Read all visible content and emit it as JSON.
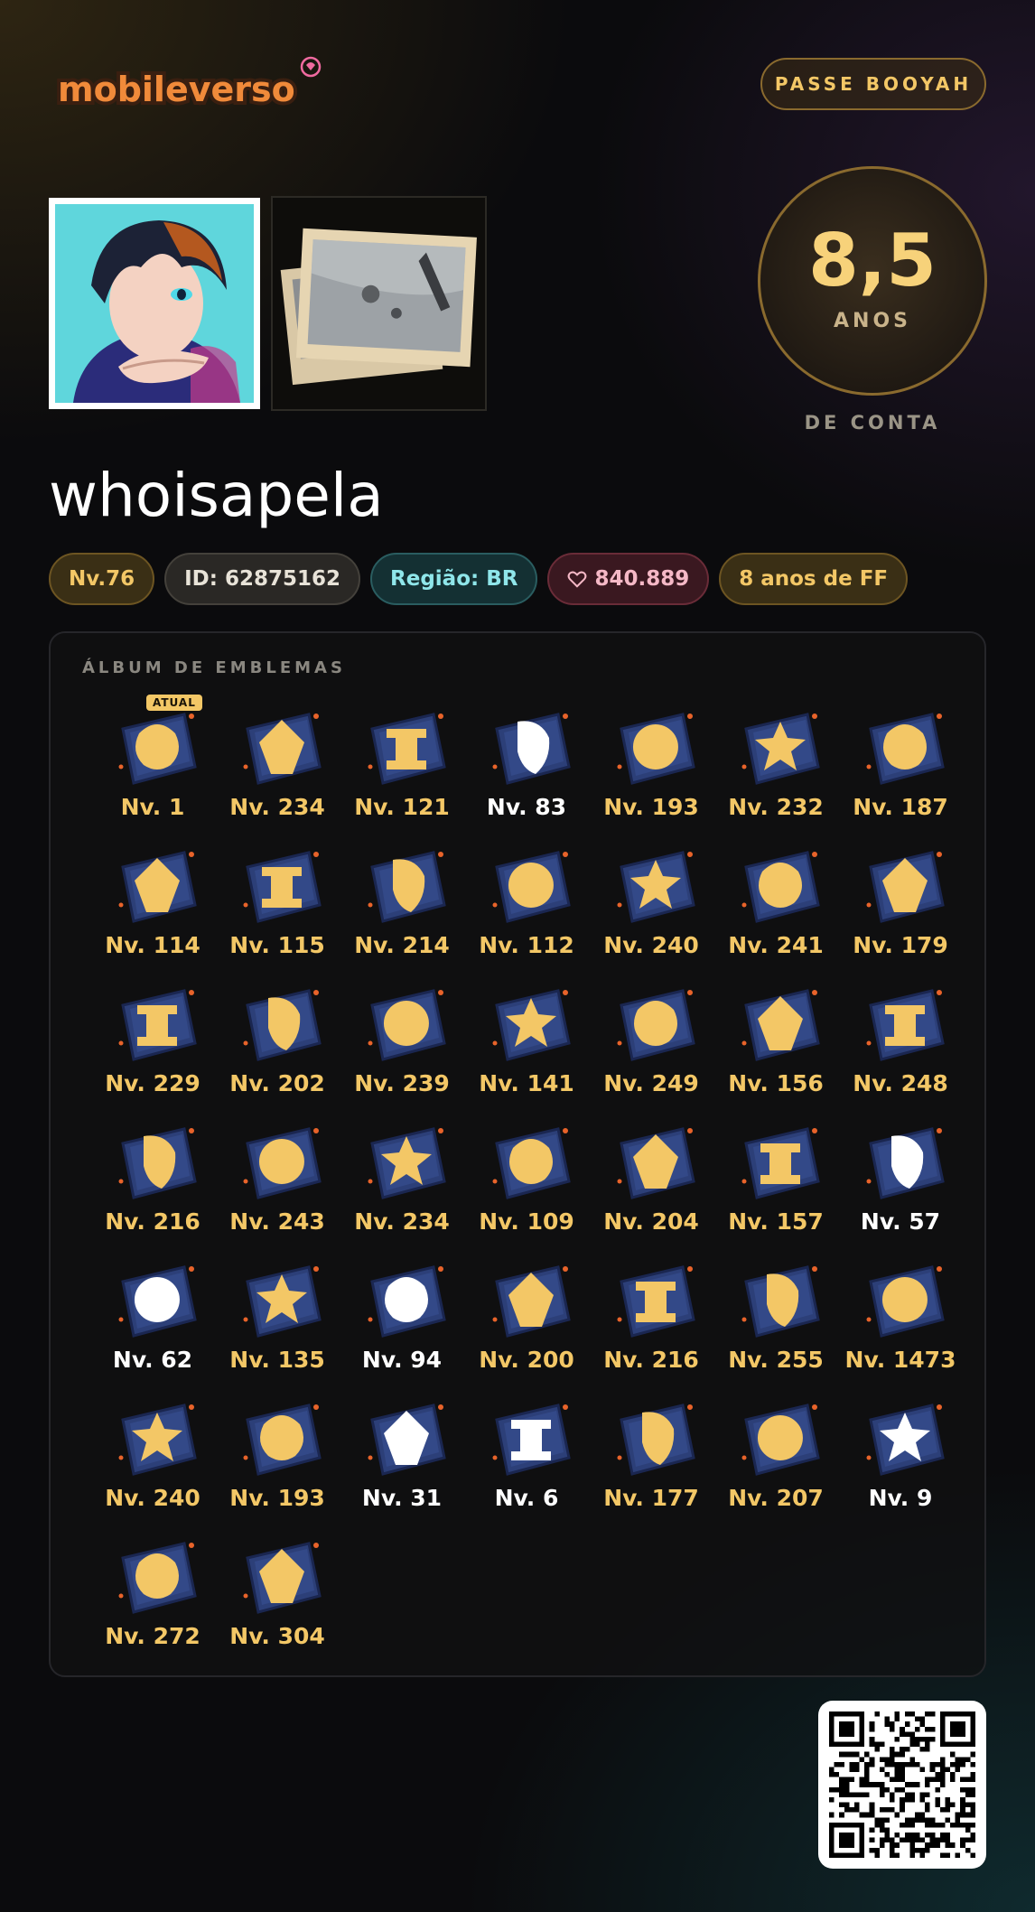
{
  "brand": {
    "logo_text": "mobileverso"
  },
  "header": {
    "pass_button": "PASSE BOOYAH"
  },
  "profile": {
    "years_value": "8,5",
    "years_unit": "ANOS",
    "years_caption": "DE CONTA",
    "username": "whoisapela",
    "pills": {
      "level": "Nv.76",
      "id": "ID: 62875162",
      "region": "Região: BR",
      "likes": "840.889",
      "years": "8 anos de FF"
    }
  },
  "album": {
    "title": "ÁLBUM DE EMBLEMAS",
    "current_tag": "ATUAL",
    "badges": [
      {
        "label": "Nv. 1",
        "tone": "gold",
        "icon": "pumpkin-emblem",
        "current": true
      },
      {
        "label": "Nv. 234",
        "tone": "gold",
        "icon": "wolf-emblem"
      },
      {
        "label": "Nv. 121",
        "tone": "gold",
        "icon": "gemini-emblem"
      },
      {
        "label": "Nv. 83",
        "tone": "white",
        "icon": "mask-emblem"
      },
      {
        "label": "Nv. 193",
        "tone": "gold",
        "icon": "sun-emblem"
      },
      {
        "label": "Nv. 232",
        "tone": "gold",
        "icon": "skull-gear-emblem"
      },
      {
        "label": "Nv. 187",
        "tone": "gold",
        "icon": "vortex-emblem"
      },
      {
        "label": "Nv. 114",
        "tone": "gold",
        "icon": "fox-emblem"
      },
      {
        "label": "Nv. 115",
        "tone": "gold",
        "icon": "crossed-swords-emblem"
      },
      {
        "label": "Nv. 214",
        "tone": "gold",
        "icon": "ghost-emblem"
      },
      {
        "label": "Nv. 112",
        "tone": "gold",
        "icon": "z-emblem"
      },
      {
        "label": "Nv. 240",
        "tone": "gold",
        "icon": "warrior-emblem"
      },
      {
        "label": "Nv. 241",
        "tone": "gold",
        "icon": "demon-skull-emblem"
      },
      {
        "label": "Nv. 179",
        "tone": "gold",
        "icon": "tv-emblem"
      },
      {
        "label": "Nv. 229",
        "tone": "gold",
        "icon": "pizza-emblem"
      },
      {
        "label": "Nv. 202",
        "tone": "gold",
        "icon": "monster-emblem"
      },
      {
        "label": "Nv. 239",
        "tone": "gold",
        "icon": "bee-emblem"
      },
      {
        "label": "Nv. 141",
        "tone": "gold",
        "icon": "hooded-emblem"
      },
      {
        "label": "Nv. 249",
        "tone": "gold",
        "icon": "box-emblem"
      },
      {
        "label": "Nv. 156",
        "tone": "gold",
        "icon": "shatter-emblem"
      },
      {
        "label": "Nv. 248",
        "tone": "gold",
        "icon": "dragon-emblem"
      },
      {
        "label": "Nv. 216",
        "tone": "gold",
        "icon": "x-eyes-emblem"
      },
      {
        "label": "Nv. 243",
        "tone": "gold",
        "icon": "tag-emblem"
      },
      {
        "label": "Nv. 234",
        "tone": "gold",
        "icon": "octopus-emblem"
      },
      {
        "label": "Nv. 109",
        "tone": "gold",
        "icon": "leo-emblem"
      },
      {
        "label": "Nv. 204",
        "tone": "gold",
        "icon": "moon-emblem"
      },
      {
        "label": "Nv. 157",
        "tone": "gold",
        "icon": "leaf-emblem"
      },
      {
        "label": "Nv. 57",
        "tone": "white",
        "icon": "cat-emblem"
      },
      {
        "label": "Nv. 62",
        "tone": "white",
        "icon": "star-emblem"
      },
      {
        "label": "Nv. 135",
        "tone": "gold",
        "icon": "frog-emblem"
      },
      {
        "label": "Nv. 94",
        "tone": "white",
        "icon": "alien-emblem"
      },
      {
        "label": "Nv. 200",
        "tone": "gold",
        "icon": "spiky-emblem"
      },
      {
        "label": "Nv. 216",
        "tone": "gold",
        "icon": "planet-emblem"
      },
      {
        "label": "Nv. 255",
        "tone": "gold",
        "icon": "lightning-emblem"
      },
      {
        "label": "Nv. 1473",
        "tone": "gold",
        "icon": "puffer-emblem"
      },
      {
        "label": "Nv. 240",
        "tone": "gold",
        "icon": "claw-emblem"
      },
      {
        "label": "Nv. 193",
        "tone": "gold",
        "icon": "atom-emblem"
      },
      {
        "label": "Nv. 31",
        "tone": "white",
        "icon": "crown-skull-emblem"
      },
      {
        "label": "Nv. 6",
        "tone": "white",
        "icon": "spray-emblem"
      },
      {
        "label": "Nv. 177",
        "tone": "gold",
        "icon": "elephant-emblem"
      },
      {
        "label": "Nv. 207",
        "tone": "gold",
        "icon": "phoenix-emblem"
      },
      {
        "label": "Nv. 9",
        "tone": "white",
        "icon": "oni-emblem"
      },
      {
        "label": "Nv. 272",
        "tone": "gold",
        "icon": "croc-emblem"
      },
      {
        "label": "Nv. 304",
        "tone": "gold",
        "icon": "bomb-emblem"
      }
    ]
  },
  "colors": {
    "gold": "#f3c766",
    "white": "#ffffff",
    "badge_base": "#2c3f78",
    "accent_border": "#8a6a2e"
  }
}
